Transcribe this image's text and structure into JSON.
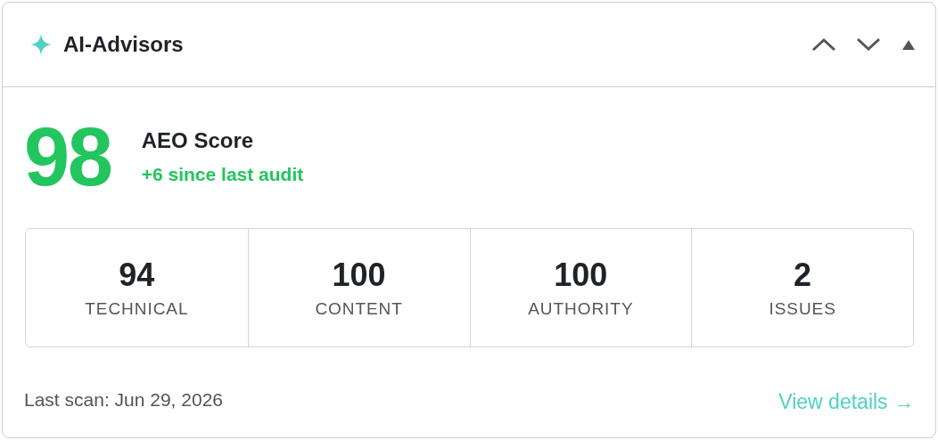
{
  "header": {
    "title": "AI-Advisors"
  },
  "score": {
    "value": "98",
    "label": "AEO Score",
    "change": "+6 since last audit"
  },
  "stats": [
    {
      "value": "94",
      "label": "TECHNICAL"
    },
    {
      "value": "100",
      "label": "CONTENT"
    },
    {
      "value": "100",
      "label": "AUTHORITY"
    },
    {
      "value": "2",
      "label": "ISSUES"
    }
  ],
  "footer": {
    "last_scan": "Last scan: Jun 29, 2026",
    "link": "View details →"
  }
}
